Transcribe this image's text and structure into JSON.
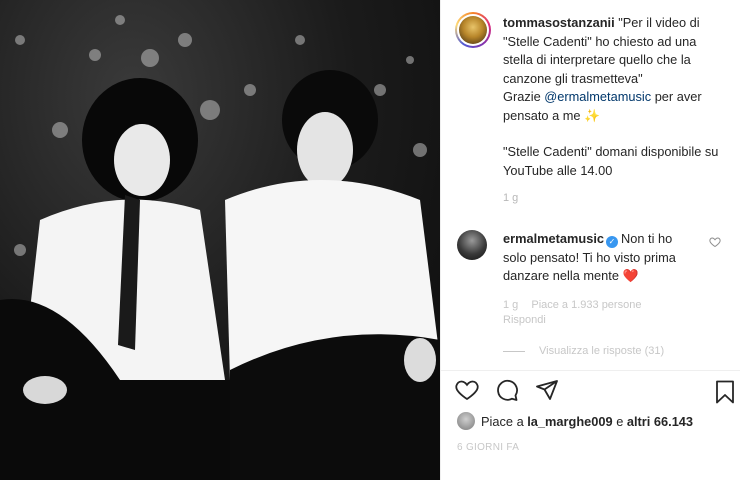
{
  "post": {
    "author": "tommasostanzanii",
    "caption_lines": [
      "\"Per il video di",
      "\"Stelle Cadenti\" ho chiesto ad una",
      "stella di interpretare quello che la",
      "canzone gli trasmetteva\""
    ],
    "thanks_prefix": "Grazie",
    "mention": "@ermalmetamusic",
    "thanks_suffix": "per aver",
    "thanks_line2": "pensato a me",
    "thanks_emoji": "✨",
    "announcement_line1": "\"Stelle Cadenti\" domani disponibile su",
    "announcement_line2": "YouTube alle 14.00",
    "time_ago": "1 g"
  },
  "comment": {
    "author": "ermalmetamusic",
    "text_part1": "Non ti ho",
    "text_line2": "solo pensato! Ti ho visto prima",
    "text_line3": "danzare nella mente",
    "heart_emoji": "❤️",
    "time": "1 g",
    "likes": "Piace a 1.933 persone",
    "reply": "Rispondi",
    "view_replies": "Visualizza le risposte (31)"
  },
  "likes": {
    "prefix": "Piace a",
    "user": "la_marghe009",
    "middle": "e",
    "others": "altri 66.143"
  },
  "date": "6 GIORNI FA",
  "icons": {
    "like": "heart-icon",
    "comment": "comment-icon",
    "share": "paper-plane-icon",
    "save": "bookmark-icon"
  }
}
